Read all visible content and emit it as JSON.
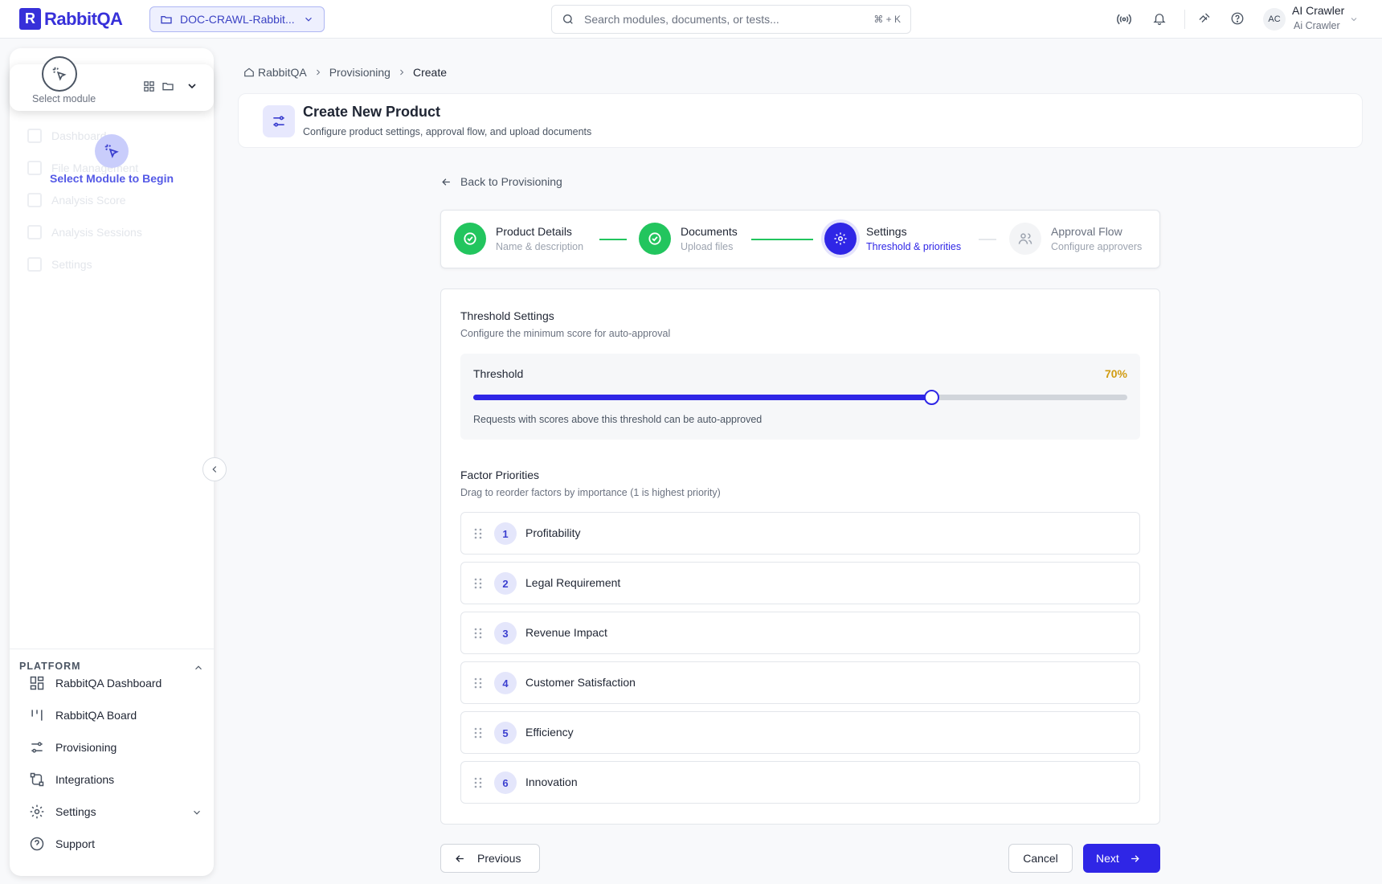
{
  "app": {
    "name": "RabbitQA",
    "logo_letter": "R"
  },
  "header": {
    "project_selector": "DOC-CRAWL-Rabbit...",
    "search_placeholder": "Search modules, documents, or tests...",
    "search_shortcut": "⌘ + K",
    "user": {
      "initials": "AC",
      "name": "AI Crawler",
      "role": "Ai Crawler"
    }
  },
  "sidebar": {
    "module_select_label": "Select module",
    "ghost_items": [
      "Dashboard",
      "File Management",
      "Analysis Score",
      "Analysis Sessions",
      "Settings"
    ],
    "begin_text": "Select Module to Begin",
    "platform_heading": "PLATFORM",
    "platform_items": [
      {
        "label": "RabbitQA Dashboard",
        "icon": "dashboard-icon"
      },
      {
        "label": "RabbitQA Board",
        "icon": "board-icon"
      },
      {
        "label": "Provisioning",
        "icon": "sliders-icon"
      },
      {
        "label": "Integrations",
        "icon": "integrations-icon"
      },
      {
        "label": "Settings",
        "icon": "gear-icon"
      },
      {
        "label": "Support",
        "icon": "help-icon"
      }
    ]
  },
  "breadcrumb": [
    "RabbitQA",
    "Provisioning",
    "Create"
  ],
  "page": {
    "title": "Create New Product",
    "subtitle": "Configure product settings, approval flow, and upload documents",
    "back_link": "Back to Provisioning"
  },
  "steps": [
    {
      "title": "Product Details",
      "subtitle": "Name & description",
      "state": "complete"
    },
    {
      "title": "Documents",
      "subtitle": "Upload files",
      "state": "complete"
    },
    {
      "title": "Settings",
      "subtitle": "Threshold & priorities",
      "state": "active"
    },
    {
      "title": "Approval Flow",
      "subtitle": "Configure approvers",
      "state": "pending"
    }
  ],
  "threshold": {
    "section_title": "Threshold Settings",
    "section_subtitle": "Configure the minimum score for auto-approval",
    "label": "Threshold",
    "value_text": "70%",
    "value_percent": 70,
    "help": "Requests with scores above this threshold can be auto-approved"
  },
  "factors": {
    "section_title": "Factor Priorities",
    "section_subtitle": "Drag to reorder factors by importance (1 is highest priority)",
    "items": [
      {
        "rank": "1",
        "label": "Profitability"
      },
      {
        "rank": "2",
        "label": "Legal Requirement"
      },
      {
        "rank": "3",
        "label": "Revenue Impact"
      },
      {
        "rank": "4",
        "label": "Customer Satisfaction"
      },
      {
        "rank": "5",
        "label": "Efficiency"
      },
      {
        "rank": "6",
        "label": "Innovation"
      }
    ]
  },
  "footer": {
    "previous": "Previous",
    "cancel": "Cancel",
    "next": "Next"
  },
  "colors": {
    "accent": "#2f26e6",
    "success": "#22c55e",
    "threshold_value": "#d19c12"
  }
}
